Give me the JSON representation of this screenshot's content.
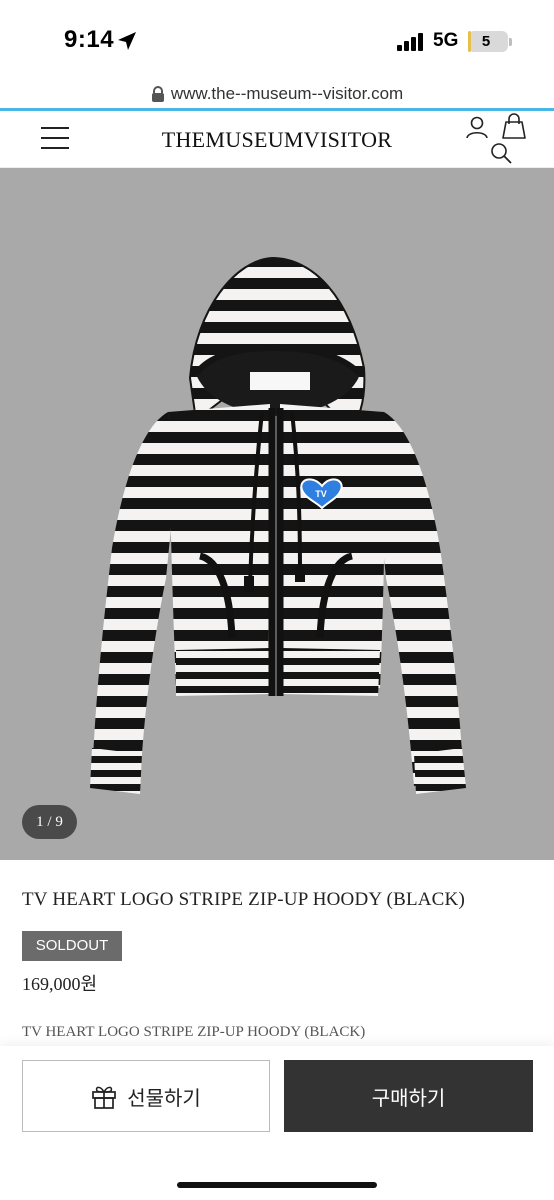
{
  "status_bar": {
    "time": "9:14",
    "network": "5G",
    "battery": "5",
    "battery_level": 0.05
  },
  "browser": {
    "url": "www.the--museum--visitor.com"
  },
  "header": {
    "logo": "THEMUSEUMVISITOR"
  },
  "gallery": {
    "counter": "1 / 9"
  },
  "product": {
    "title": "TV HEART LOGO STRIPE ZIP-UP HOODY (BLACK)",
    "badge": "SOLDOUT",
    "price": "169,000원",
    "subtitle": "TV HEART LOGO STRIPE ZIP-UP HOODY (BLACK)",
    "patch_text": "TV"
  },
  "actions": {
    "gift_label": "선물하기",
    "buy_label": "구매하기"
  },
  "colors": {
    "accent_line": "#48b7e8",
    "buy_button": "#333333",
    "soldout_badge": "#6b6b6b",
    "image_background": "#a9a9a9",
    "patch": "#2f7fe0"
  },
  "icons": [
    "location-arrow-icon",
    "signal-icon",
    "battery-icon",
    "lock-icon",
    "menu-icon",
    "user-icon",
    "bag-icon",
    "search-icon",
    "gift-icon"
  ]
}
